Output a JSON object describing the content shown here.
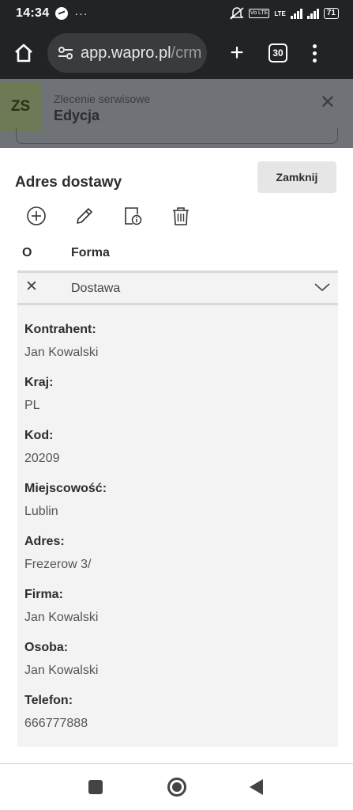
{
  "status_bar": {
    "time": "14:34",
    "dots": "···",
    "lte": "LTE",
    "vo": "Vo LTE",
    "battery": "71"
  },
  "browser": {
    "url_main": "app.wapro.pl",
    "url_path": "/crm",
    "tab_count": "30",
    "plus": "+"
  },
  "page_header": {
    "avatar": "ZS",
    "subtitle": "Zlecenie serwisowe",
    "title": "Edycja",
    "close": "✕"
  },
  "modal": {
    "title": "Adres dostawy",
    "close_button": "Zamknij",
    "columns": {
      "o": "O",
      "forma": "Forma"
    },
    "row": {
      "remove": "✕",
      "forma": "Dostawa"
    },
    "fields": [
      {
        "label": "Kontrahent:",
        "value": "Jan Kowalski"
      },
      {
        "label": "Kraj:",
        "value": "PL"
      },
      {
        "label": "Kod:",
        "value": "20209"
      },
      {
        "label": "Miejscowość:",
        "value": "Lublin"
      },
      {
        "label": "Adres:",
        "value": "Frezerow 3/"
      },
      {
        "label": "Firma:",
        "value": "Jan Kowalski"
      },
      {
        "label": "Osoba:",
        "value": "Jan Kowalski"
      },
      {
        "label": "Telefon:",
        "value": "666777888"
      }
    ]
  },
  "icons": [
    "home-icon",
    "site-settings-icon",
    "plus-icon",
    "tab-switcher-icon",
    "more-vert-icon",
    "add-circle-icon",
    "pencil-icon",
    "document-info-icon",
    "trash-icon",
    "chevron-down-icon",
    "close-icon"
  ]
}
